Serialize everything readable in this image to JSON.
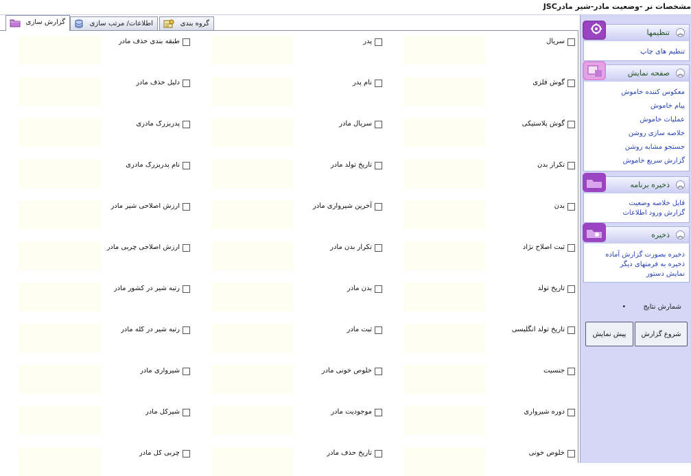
{
  "window": {
    "title": "مشخصات نر -وضعیت مادر-شیر مادرJSC"
  },
  "tabs": [
    {
      "label": "گزارش سازی",
      "active": true
    },
    {
      "label": "اطلاعات/ مرتب سازی",
      "active": false
    },
    {
      "label": "گروه بندی",
      "active": false
    }
  ],
  "sidebar": {
    "panels": [
      {
        "title": "تنظیمها",
        "links": [
          "تنظیم های چاپ"
        ]
      },
      {
        "title": "صفحه نمایش",
        "links": [
          "معکوس کننده خاموش",
          "پیام خاموش",
          "عملیات خاموش",
          "خلاصه سازی روشن",
          "جستجو مشابه روشن",
          "گزارش سریع خاموش"
        ]
      },
      {
        "title": "ذخیره برنامه",
        "links": [
          "فایل خلاصه وضعیت",
          "گزارش ورود اطلاعات"
        ]
      },
      {
        "title": "ذخیره",
        "links": [
          "ذخیره بصورت گزارش آماده",
          "ذخیره به فرمتهای دیگر",
          "نمایش دستور"
        ]
      }
    ],
    "results_label": "شمارش نتایج",
    "results_value": "•",
    "start_button": "شروع گزارش",
    "preview_button": "پیش نمایش"
  },
  "fields": {
    "right": [
      "سریال",
      "گوش فلزی",
      "گوش پلاستیکی",
      "تکرار بدن",
      "بدن",
      "ثبت اصلاح نژاد",
      "تاریخ تولد",
      "تاریخ تولد انگلیسی",
      "جنسیت",
      "دوره شیرواری",
      "خلوص خونی"
    ],
    "middle": [
      "پدر",
      "نام پدر",
      "سریال مادر",
      "تاریخ تولد مادر",
      "آخرین شیرواری مادر",
      "تکرار بدن مادر",
      "بدن مادر",
      "ثبت مادر",
      "خلوص خونی مادر",
      "موجودیت مادر",
      "تاریخ حذف مادر"
    ],
    "left": [
      "طبقه بندی حذف مادر",
      "دلیل حذف مادر",
      "پدربزرگ مادری",
      "نام پدربزرگ مادری",
      "ارزش اصلاحی شیر مادر",
      "ارزش اصلاحی چربی مادر",
      "رتبه شیر در کشور مادر",
      "رتبه شیر در گله مادر",
      "شیرواری مادر",
      "شیرکل مادر",
      "چربی کل مادر"
    ]
  },
  "colors": {
    "sidebar_bg": "#d6d6f7",
    "link": "#2742b8",
    "field_highlight": "#fefff0"
  }
}
